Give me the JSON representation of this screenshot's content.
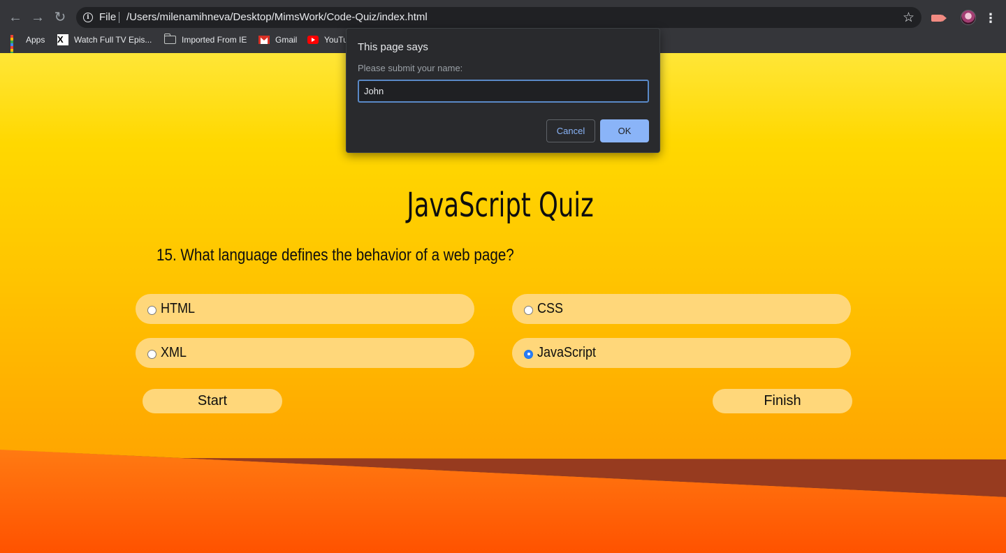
{
  "browser": {
    "scheme_label": "File",
    "url": "/Users/milenamihneva/Desktop/MimsWork/Code-Quiz/index.html",
    "bookmarks": [
      {
        "label": "Apps",
        "icon": "apps-grid-icon"
      },
      {
        "label": "Watch Full TV Epis...",
        "icon": "x-site-icon"
      },
      {
        "label": "Imported From IE",
        "icon": "folder-icon"
      },
      {
        "label": "Gmail",
        "icon": "gmail-icon"
      },
      {
        "label": "YouTu",
        "icon": "youtube-icon"
      }
    ]
  },
  "dialog": {
    "title": "This page says",
    "message": "Please submit your name:",
    "input_value": "John",
    "cancel_label": "Cancel",
    "ok_label": "OK"
  },
  "quiz": {
    "title": "JavaScript Quiz",
    "question": "15. What language defines the behavior of a web page?",
    "options": [
      {
        "label": "HTML",
        "checked": false
      },
      {
        "label": "CSS",
        "checked": false
      },
      {
        "label": "XML",
        "checked": false
      },
      {
        "label": "JavaScript",
        "checked": true
      }
    ],
    "start_label": "Start",
    "finish_label": "Finish"
  },
  "colors": {
    "background_top": "#ffe637",
    "background_bottom": "#ff9a00",
    "option_fill": "#ffd77a",
    "dialog_bg": "#292a2d",
    "ok_button": "#8ab4f8"
  }
}
